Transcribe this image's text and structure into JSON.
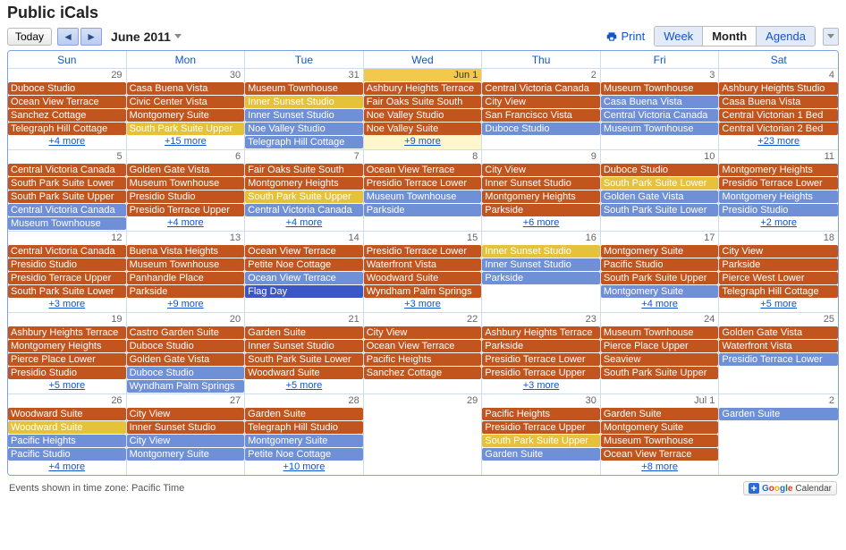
{
  "title": "Public iCals",
  "toolbar": {
    "today": "Today",
    "current": "June 2011",
    "print": "Print",
    "views": {
      "week": "Week",
      "month": "Month",
      "agenda": "Agenda"
    },
    "active_view": "month"
  },
  "day_headers": [
    "Sun",
    "Mon",
    "Tue",
    "Wed",
    "Thu",
    "Fri",
    "Sat"
  ],
  "footer": {
    "tz": "Events shown in time zone: Pacific Time",
    "gcal": "Google Calendar"
  },
  "weeks": [
    [
      {
        "num": "29",
        "today": false,
        "events": [
          {
            "t": "Duboce Studio",
            "c": "orange"
          },
          {
            "t": "Ocean View Terrace",
            "c": "orange"
          },
          {
            "t": "Sanchez Cottage",
            "c": "orange"
          },
          {
            "t": "Telegraph Hill Cottage",
            "c": "orange"
          }
        ],
        "more": "+4 more"
      },
      {
        "num": "30",
        "today": false,
        "events": [
          {
            "t": "Casa Buena Vista",
            "c": "orange"
          },
          {
            "t": "Civic Center Vista",
            "c": "orange"
          },
          {
            "t": "Montgomery Suite",
            "c": "orange"
          },
          {
            "t": "South Park Suite Upper",
            "c": "yellow"
          }
        ],
        "more": "+15 more"
      },
      {
        "num": "31",
        "today": false,
        "events": [
          {
            "t": "Museum Townhouse",
            "c": "orange"
          },
          {
            "t": "Inner Sunset Studio",
            "c": "yellow"
          },
          {
            "t": "Inner Sunset Studio",
            "c": "blue"
          },
          {
            "t": "Noe Valley Studio",
            "c": "blue"
          },
          {
            "t": "Telegraph Hill Cottage",
            "c": "blue"
          }
        ],
        "more": ""
      },
      {
        "num": "Jun 1",
        "today": true,
        "events": [
          {
            "t": "Ashbury Heights Terrace",
            "c": "orange"
          },
          {
            "t": "Fair Oaks Suite South",
            "c": "orange"
          },
          {
            "t": "Noe Valley Studio",
            "c": "orange"
          },
          {
            "t": "Noe Valley Suite",
            "c": "orange"
          }
        ],
        "more": "+9 more"
      },
      {
        "num": "2",
        "today": false,
        "events": [
          {
            "t": "Central Victoria Canada",
            "c": "orange"
          },
          {
            "t": "City View",
            "c": "orange"
          },
          {
            "t": "San Francisco Vista",
            "c": "orange"
          },
          {
            "t": "Duboce Studio",
            "c": "blue"
          }
        ],
        "more": ""
      },
      {
        "num": "3",
        "today": false,
        "events": [
          {
            "t": "Museum Townhouse",
            "c": "orange"
          },
          {
            "t": "Casa Buena Vista",
            "c": "blue"
          },
          {
            "t": "Central Victoria Canada",
            "c": "blue"
          },
          {
            "t": "Museum Townhouse",
            "c": "blue"
          }
        ],
        "more": ""
      },
      {
        "num": "4",
        "today": false,
        "events": [
          {
            "t": "Ashbury Heights Studio",
            "c": "orange"
          },
          {
            "t": "Casa Buena Vista",
            "c": "orange"
          },
          {
            "t": "Central Victorian 1 Bed",
            "c": "orange"
          },
          {
            "t": "Central Victorian 2 Bed",
            "c": "orange"
          }
        ],
        "more": "+23 more"
      }
    ],
    [
      {
        "num": "5",
        "today": false,
        "events": [
          {
            "t": "Central Victoria Canada",
            "c": "orange"
          },
          {
            "t": "South Park Suite Lower",
            "c": "orange"
          },
          {
            "t": "South Park Suite Upper",
            "c": "orange"
          },
          {
            "t": "Central Victoria Canada",
            "c": "blue"
          },
          {
            "t": "Museum Townhouse",
            "c": "blue"
          }
        ],
        "more": ""
      },
      {
        "num": "6",
        "today": false,
        "events": [
          {
            "t": "Golden Gate Vista",
            "c": "orange"
          },
          {
            "t": "Museum Townhouse",
            "c": "orange"
          },
          {
            "t": "Presidio Studio",
            "c": "orange"
          },
          {
            "t": "Presidio Terrace Upper",
            "c": "orange"
          }
        ],
        "more": "+4 more"
      },
      {
        "num": "7",
        "today": false,
        "events": [
          {
            "t": "Fair Oaks Suite South",
            "c": "orange"
          },
          {
            "t": "Montgomery Heights",
            "c": "orange"
          },
          {
            "t": "South Park Suite Upper",
            "c": "yellow"
          },
          {
            "t": "Central Victoria Canada",
            "c": "blue"
          }
        ],
        "more": "+4 more"
      },
      {
        "num": "8",
        "today": false,
        "events": [
          {
            "t": "Ocean View Terrace",
            "c": "orange"
          },
          {
            "t": "Presidio Terrace Lower",
            "c": "orange"
          },
          {
            "t": "Museum Townhouse",
            "c": "blue"
          },
          {
            "t": "Parkside",
            "c": "blue"
          }
        ],
        "more": ""
      },
      {
        "num": "9",
        "today": false,
        "events": [
          {
            "t": "City View",
            "c": "orange"
          },
          {
            "t": "Inner Sunset Studio",
            "c": "orange"
          },
          {
            "t": "Montgomery Heights",
            "c": "orange"
          },
          {
            "t": "Parkside",
            "c": "orange"
          }
        ],
        "more": "+6 more"
      },
      {
        "num": "10",
        "today": false,
        "events": [
          {
            "t": "Duboce Studio",
            "c": "orange"
          },
          {
            "t": "South Park Suite Lower",
            "c": "yellow"
          },
          {
            "t": "Golden Gate Vista",
            "c": "blue"
          },
          {
            "t": "South Park Suite Lower",
            "c": "blue"
          }
        ],
        "more": ""
      },
      {
        "num": "11",
        "today": false,
        "events": [
          {
            "t": "Montgomery Heights",
            "c": "orange"
          },
          {
            "t": "Presidio Terrace Lower",
            "c": "orange"
          },
          {
            "t": "Montgomery Heights",
            "c": "blue"
          },
          {
            "t": "Presidio Studio",
            "c": "blue"
          }
        ],
        "more": "+2 more"
      }
    ],
    [
      {
        "num": "12",
        "today": false,
        "events": [
          {
            "t": "Central Victoria Canada",
            "c": "orange"
          },
          {
            "t": "Presidio Studio",
            "c": "orange"
          },
          {
            "t": "Presidio Terrace Upper",
            "c": "orange"
          },
          {
            "t": "South Park Suite Lower",
            "c": "orange"
          }
        ],
        "more": "+3 more"
      },
      {
        "num": "13",
        "today": false,
        "events": [
          {
            "t": "Buena Vista Heights",
            "c": "orange"
          },
          {
            "t": "Museum Townhouse",
            "c": "orange"
          },
          {
            "t": "Panhandle Place",
            "c": "orange"
          },
          {
            "t": "Parkside",
            "c": "orange"
          }
        ],
        "more": "+9 more"
      },
      {
        "num": "14",
        "today": false,
        "events": [
          {
            "t": "Ocean View Terrace",
            "c": "orange"
          },
          {
            "t": "Petite Noe Cottage",
            "c": "orange"
          },
          {
            "t": "Ocean View Terrace",
            "c": "blue"
          },
          {
            "t": "Flag Day",
            "c": "navy"
          }
        ],
        "more": ""
      },
      {
        "num": "15",
        "today": false,
        "events": [
          {
            "t": "Presidio Terrace Lower",
            "c": "orange"
          },
          {
            "t": "Waterfront Vista",
            "c": "orange"
          },
          {
            "t": "Woodward Suite",
            "c": "orange"
          },
          {
            "t": "Wyndham Palm Springs",
            "c": "orange"
          }
        ],
        "more": "+3 more"
      },
      {
        "num": "16",
        "today": false,
        "events": [
          {
            "t": "Inner Sunset Studio",
            "c": "yellow"
          },
          {
            "t": "Inner Sunset Studio",
            "c": "blue"
          },
          {
            "t": "Parkside",
            "c": "blue"
          }
        ],
        "more": ""
      },
      {
        "num": "17",
        "today": false,
        "events": [
          {
            "t": "Montgomery Suite",
            "c": "orange"
          },
          {
            "t": "Pacific Studio",
            "c": "orange"
          },
          {
            "t": "South Park Suite Upper",
            "c": "orange"
          },
          {
            "t": "Montgomery Suite",
            "c": "blue"
          }
        ],
        "more": "+4 more"
      },
      {
        "num": "18",
        "today": false,
        "events": [
          {
            "t": "City View",
            "c": "orange"
          },
          {
            "t": "Parkside",
            "c": "orange"
          },
          {
            "t": "Pierce West Lower",
            "c": "orange"
          },
          {
            "t": "Telegraph Hill Cottage",
            "c": "orange"
          }
        ],
        "more": "+5 more"
      }
    ],
    [
      {
        "num": "19",
        "today": false,
        "events": [
          {
            "t": "Ashbury Heights Terrace",
            "c": "orange"
          },
          {
            "t": "Montgomery Heights",
            "c": "orange"
          },
          {
            "t": "Pierce Place Lower",
            "c": "orange"
          },
          {
            "t": "Presidio Studio",
            "c": "orange"
          }
        ],
        "more": "+5 more"
      },
      {
        "num": "20",
        "today": false,
        "events": [
          {
            "t": "Castro Garden Suite",
            "c": "orange"
          },
          {
            "t": "Duboce Studio",
            "c": "orange"
          },
          {
            "t": "Golden Gate Vista",
            "c": "orange"
          },
          {
            "t": "Duboce Studio",
            "c": "blue"
          },
          {
            "t": "Wyndham Palm Springs",
            "c": "blue"
          }
        ],
        "more": ""
      },
      {
        "num": "21",
        "today": false,
        "events": [
          {
            "t": "Garden Suite",
            "c": "orange"
          },
          {
            "t": "Inner Sunset Studio",
            "c": "orange"
          },
          {
            "t": "South Park Suite Lower",
            "c": "orange"
          },
          {
            "t": "Woodward Suite",
            "c": "orange"
          }
        ],
        "more": "+5 more"
      },
      {
        "num": "22",
        "today": false,
        "events": [
          {
            "t": "City View",
            "c": "orange"
          },
          {
            "t": "Ocean View Terrace",
            "c": "orange"
          },
          {
            "t": "Pacific Heights",
            "c": "orange"
          },
          {
            "t": "Sanchez Cottage",
            "c": "orange"
          }
        ],
        "more": ""
      },
      {
        "num": "23",
        "today": false,
        "events": [
          {
            "t": "Ashbury Heights Terrace",
            "c": "orange"
          },
          {
            "t": "Parkside",
            "c": "orange"
          },
          {
            "t": "Presidio Terrace Lower",
            "c": "orange"
          },
          {
            "t": "Presidio Terrace Upper",
            "c": "orange"
          }
        ],
        "more": "+3 more"
      },
      {
        "num": "24",
        "today": false,
        "events": [
          {
            "t": "Museum Townhouse",
            "c": "orange"
          },
          {
            "t": "Pierce Place Upper",
            "c": "orange"
          },
          {
            "t": "Seaview",
            "c": "orange"
          },
          {
            "t": "South Park Suite Upper",
            "c": "orange"
          }
        ],
        "more": ""
      },
      {
        "num": "25",
        "today": false,
        "events": [
          {
            "t": "Golden Gate Vista",
            "c": "orange"
          },
          {
            "t": "Waterfront Vista",
            "c": "orange"
          },
          {
            "t": "Presidio Terrace Lower",
            "c": "blue"
          }
        ],
        "more": ""
      }
    ],
    [
      {
        "num": "26",
        "today": false,
        "events": [
          {
            "t": "Woodward Suite",
            "c": "orange"
          },
          {
            "t": "Woodward Suite",
            "c": "yellow"
          },
          {
            "t": "Pacific Heights",
            "c": "blue"
          },
          {
            "t": "Pacific Studio",
            "c": "blue"
          }
        ],
        "more": "+4 more"
      },
      {
        "num": "27",
        "today": false,
        "events": [
          {
            "t": "City View",
            "c": "orange"
          },
          {
            "t": "Inner Sunset Studio",
            "c": "orange"
          },
          {
            "t": "City View",
            "c": "blue"
          },
          {
            "t": "Montgomery Suite",
            "c": "blue"
          }
        ],
        "more": ""
      },
      {
        "num": "28",
        "today": false,
        "events": [
          {
            "t": "Garden Suite",
            "c": "orange"
          },
          {
            "t": "Telegraph Hill Studio",
            "c": "orange"
          },
          {
            "t": "Montgomery Suite",
            "c": "blue"
          },
          {
            "t": "Petite Noe Cottage",
            "c": "blue"
          }
        ],
        "more": "+10 more"
      },
      {
        "num": "29",
        "today": false,
        "events": [],
        "more": ""
      },
      {
        "num": "30",
        "today": false,
        "events": [
          {
            "t": "Pacific Heights",
            "c": "orange"
          },
          {
            "t": "Presidio Terrace Upper",
            "c": "orange"
          },
          {
            "t": "South Park Suite Upper",
            "c": "yellow"
          },
          {
            "t": "Garden Suite",
            "c": "blue"
          }
        ],
        "more": ""
      },
      {
        "num": "Jul 1",
        "today": false,
        "events": [
          {
            "t": "Garden Suite",
            "c": "orange"
          },
          {
            "t": "Montgomery Suite",
            "c": "orange"
          },
          {
            "t": "Museum Townhouse",
            "c": "orange"
          },
          {
            "t": "Ocean View Terrace",
            "c": "orange"
          }
        ],
        "more": "+8 more"
      },
      {
        "num": "2",
        "today": false,
        "events": [
          {
            "t": "Garden Suite",
            "c": "blue"
          }
        ],
        "more": ""
      }
    ]
  ]
}
